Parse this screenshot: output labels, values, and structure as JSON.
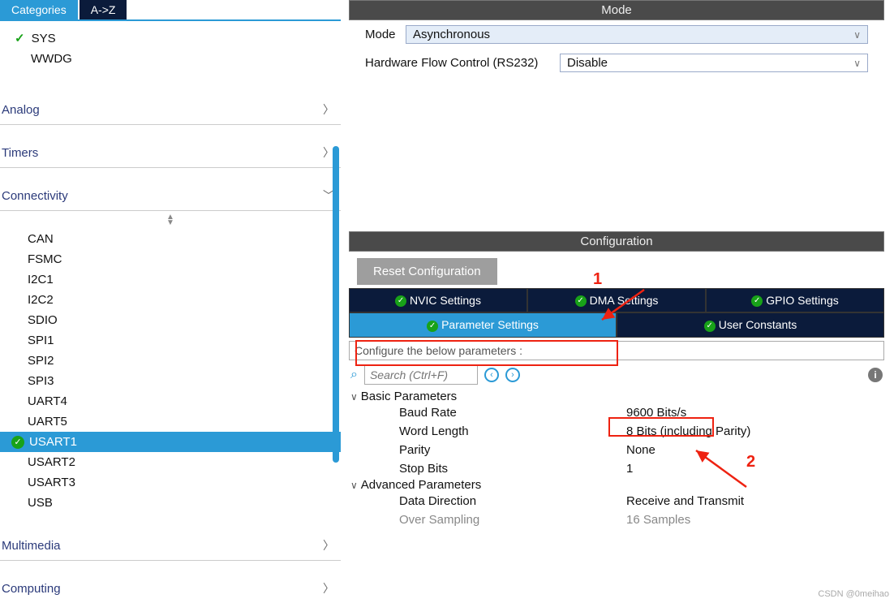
{
  "left": {
    "tabs": {
      "categories": "Categories",
      "az": "A->Z"
    },
    "top_items": [
      {
        "label": "SYS",
        "checked": true
      },
      {
        "label": "WWDG",
        "checked": false
      }
    ],
    "sections": [
      {
        "label": "Analog",
        "expanded": false
      },
      {
        "label": "Timers",
        "expanded": false
      },
      {
        "label": "Connectivity",
        "expanded": true
      },
      {
        "label": "Multimedia",
        "expanded": false
      },
      {
        "label": "Computing",
        "expanded": false
      }
    ],
    "connectivity_items": [
      "CAN",
      "FSMC",
      "I2C1",
      "I2C2",
      "SDIO",
      "SPI1",
      "SPI2",
      "SPI3",
      "UART4",
      "UART5",
      "USART1",
      "USART2",
      "USART3",
      "USB"
    ],
    "selected_item": "USART1"
  },
  "mode": {
    "header": "Mode",
    "mode_label": "Mode",
    "mode_value": "Asynchronous",
    "hwfc_label": "Hardware Flow Control (RS232)",
    "hwfc_value": "Disable"
  },
  "config": {
    "header": "Configuration",
    "reset_btn": "Reset Configuration",
    "tabs": {
      "nvic": "NVIC Settings",
      "dma": "DMA Settings",
      "gpio": "GPIO Settings",
      "param": "Parameter Settings",
      "user": "User Constants"
    },
    "instr": "Configure the below parameters :",
    "search_placeholder": "Search (Ctrl+F)",
    "groups": {
      "basic": {
        "title": "Basic Parameters",
        "baud_label": "Baud Rate",
        "baud_value": "9600 Bits/s",
        "wordlen_label": "Word Length",
        "wordlen_value": "8 Bits (including Parity)",
        "parity_label": "Parity",
        "parity_value": "None",
        "stopbits_label": "Stop Bits",
        "stopbits_value": "1"
      },
      "adv": {
        "title": "Advanced Parameters",
        "datadir_label": "Data Direction",
        "datadir_value": "Receive and Transmit",
        "oversamp_label": "Over Sampling",
        "oversamp_value": "16 Samples"
      }
    }
  },
  "annotations": {
    "one": "1",
    "two": "2"
  },
  "watermark": "CSDN @0meihao"
}
